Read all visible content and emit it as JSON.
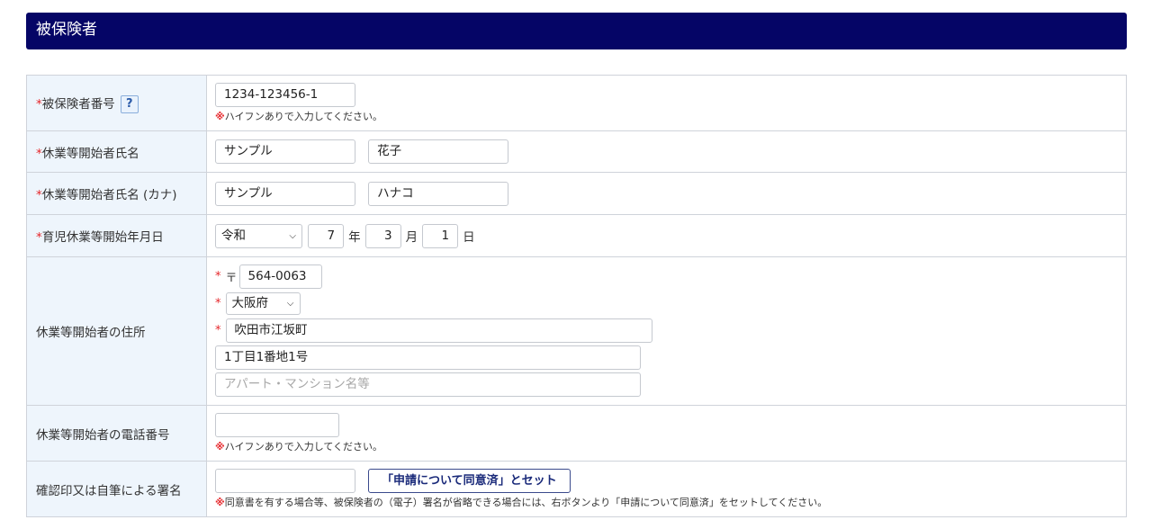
{
  "section_title": "被保険者",
  "required_mark": "*",
  "note_mark": "※",
  "help_label": "?",
  "insured_number": {
    "label": "被保険者番号",
    "value": "1234-123456-1",
    "note": "ハイフンありで入力してください。"
  },
  "name": {
    "label": "休業等開始者氏名",
    "last": "サンプル",
    "first": "花子"
  },
  "kana": {
    "label": "休業等開始者氏名 (カナ)",
    "last": "サンプル",
    "first": "ハナコ"
  },
  "start_date": {
    "label": "育児休業等開始年月日",
    "era": "令和",
    "year": "7",
    "year_unit": "年",
    "month": "3",
    "month_unit": "月",
    "day": "1",
    "day_unit": "日"
  },
  "address": {
    "label": "休業等開始者の住所",
    "postal_mark": "〒",
    "postal": "564-0063",
    "prefecture": "大阪府",
    "city": "吹田市江坂町",
    "street": "1丁目1番地1号",
    "building_placeholder": "アパート・マンション名等"
  },
  "phone": {
    "label": "休業等開始者の電話番号",
    "value": "",
    "note": "ハイフンありで入力してください。"
  },
  "signature": {
    "label": "確認印又は自筆による署名",
    "value": "",
    "button_label": "「申請について同意済」とセット",
    "note": "同意書を有する場合等、被保険者の（電子）署名が省略できる場合には、右ボタンより「申請について同意済」をセットしてください。"
  },
  "chevron_icon": "chevron-down-icon",
  "colors": {
    "header_bg": "#050566",
    "label_bg": "#eef5fc",
    "required": "#e5262a",
    "border": "#cfd3da"
  }
}
